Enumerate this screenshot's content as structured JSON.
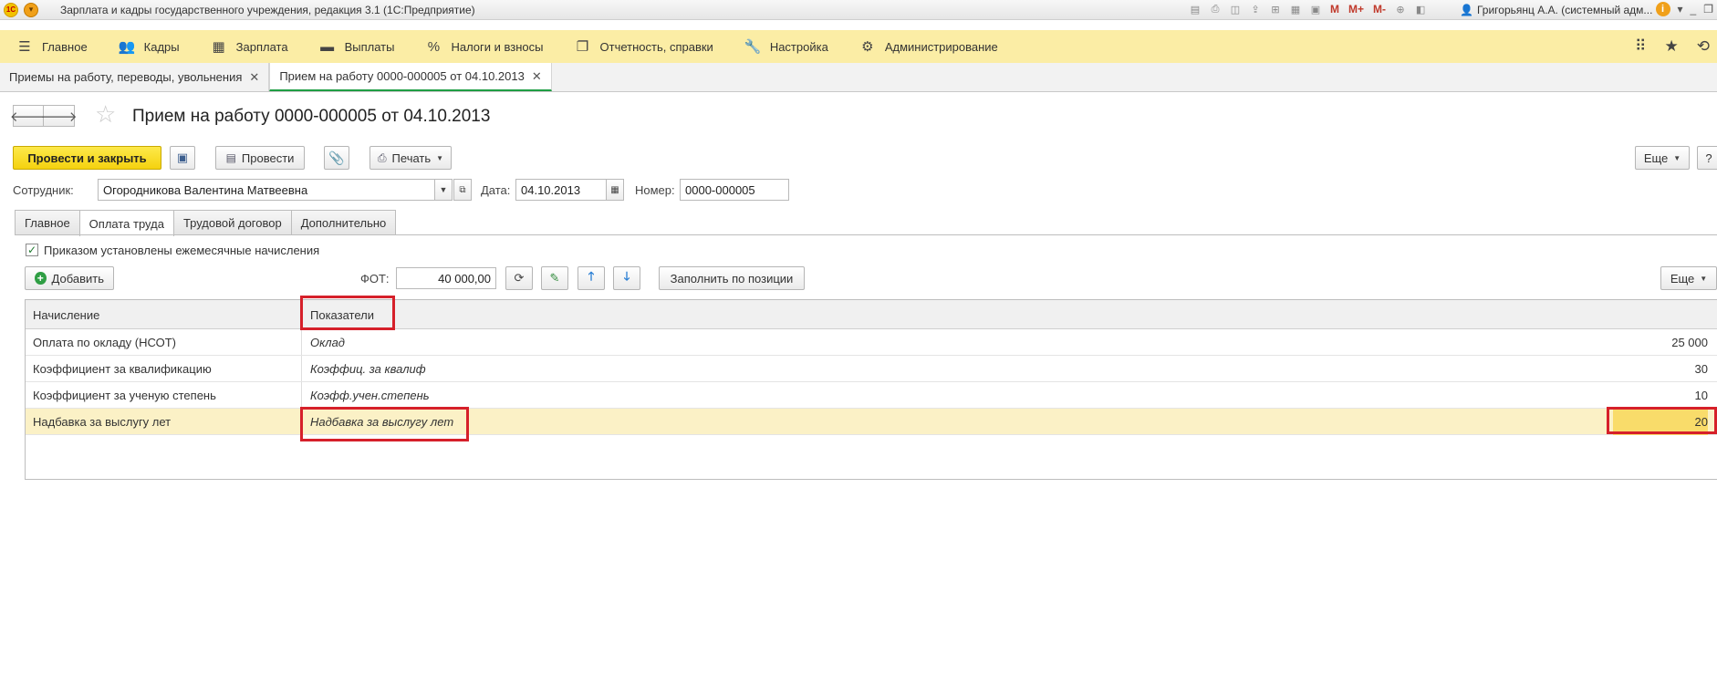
{
  "window": {
    "logo": "1С",
    "title": "Зарплата и кадры государственного учреждения, редакция 3.1  (1С:Предприятие)",
    "user": "Григорьянц А.А. (системный адм...",
    "memory_buttons": [
      "M",
      "M+",
      "M-"
    ]
  },
  "sections": [
    {
      "icon": "hamburger-icon",
      "label": "Главное"
    },
    {
      "icon": "people-icon",
      "label": "Кадры"
    },
    {
      "icon": "calculator-icon",
      "label": "Зарплата"
    },
    {
      "icon": "wallet-icon",
      "label": "Выплаты"
    },
    {
      "icon": "percent-icon",
      "label": "Налоги и взносы"
    },
    {
      "icon": "reports-icon",
      "label": "Отчетность, справки"
    },
    {
      "icon": "wrench-icon",
      "label": "Настройка"
    },
    {
      "icon": "gear-icon",
      "label": "Администрирование"
    }
  ],
  "open_windows": [
    {
      "label": "Приемы на работу, переводы, увольнения",
      "active": false
    },
    {
      "label": "Прием на работу 0000-000005 от 04.10.2013",
      "active": true
    }
  ],
  "form": {
    "title": "Прием на работу 0000-000005 от 04.10.2013",
    "post_and_close": "Провести и закрыть",
    "post": "Провести",
    "print": "Печать",
    "more": "Еще",
    "help": "?",
    "employee_label": "Сотрудник:",
    "employee_value": "Огородникова Валентина Матвеевна",
    "date_label": "Дата:",
    "date_value": "04.10.2013",
    "number_label": "Номер:",
    "number_value": "0000-000005"
  },
  "form_tabs": [
    {
      "label": "Главное",
      "active": false
    },
    {
      "label": "Оплата труда",
      "active": true
    },
    {
      "label": "Трудовой договор",
      "active": false
    },
    {
      "label": "Дополнительно",
      "active": false
    }
  ],
  "payment": {
    "monthly_checkbox_label": "Приказом установлены ежемесячные начисления",
    "monthly_checked": true,
    "add_button": "Добавить",
    "fot_label": "ФОТ:",
    "fot_value": "40 000,00",
    "fill_by_position": "Заполнить по позиции",
    "more": "Еще"
  },
  "accruals_table": {
    "headers": {
      "accrual": "Начисление",
      "indicators": "Показатели"
    },
    "rows": [
      {
        "accrual": "Оплата по окладу (НСОТ)",
        "indicator": "Оклад",
        "value": "25 000",
        "selected": false
      },
      {
        "accrual": "Коэффициент за квалификацию",
        "indicator": "Коэффиц. за квалиф",
        "value": "30",
        "selected": false
      },
      {
        "accrual": "Коэффициент за ученую степень",
        "indicator": "Коэфф.учен.степень",
        "value": "10",
        "selected": false
      },
      {
        "accrual": "Надбавка за выслугу лет",
        "indicator": "Надбавка за выслугу лет",
        "value": "20",
        "selected": true
      }
    ]
  },
  "highlight_color": "#d6202a",
  "accent_color": "#fbeda5"
}
